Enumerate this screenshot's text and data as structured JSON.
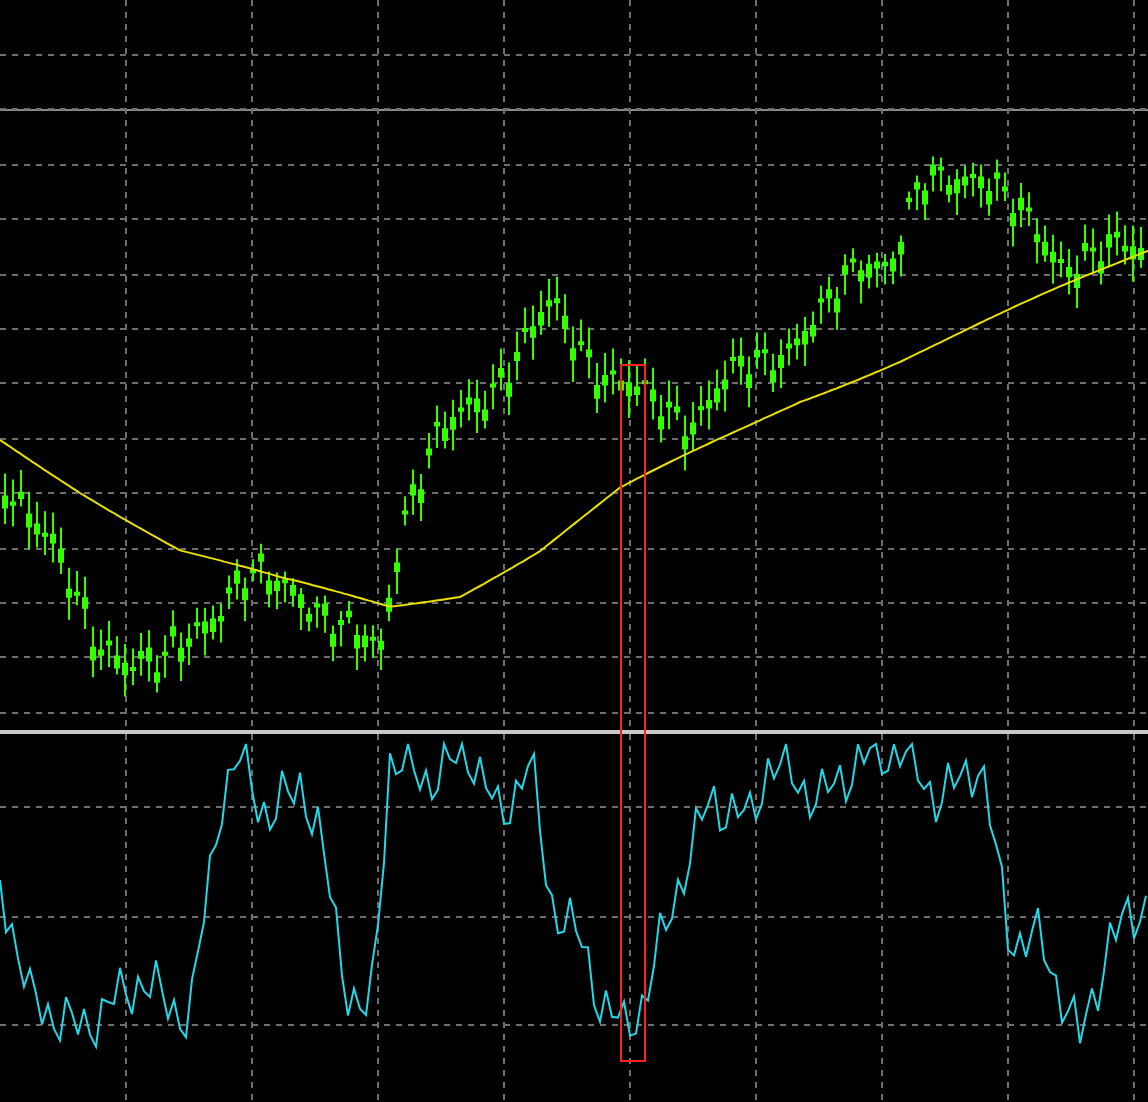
{
  "panels": [
    {
      "kind": "price"
    },
    {
      "kind": "oscillator"
    }
  ],
  "highlight": {
    "visible": true
  }
}
